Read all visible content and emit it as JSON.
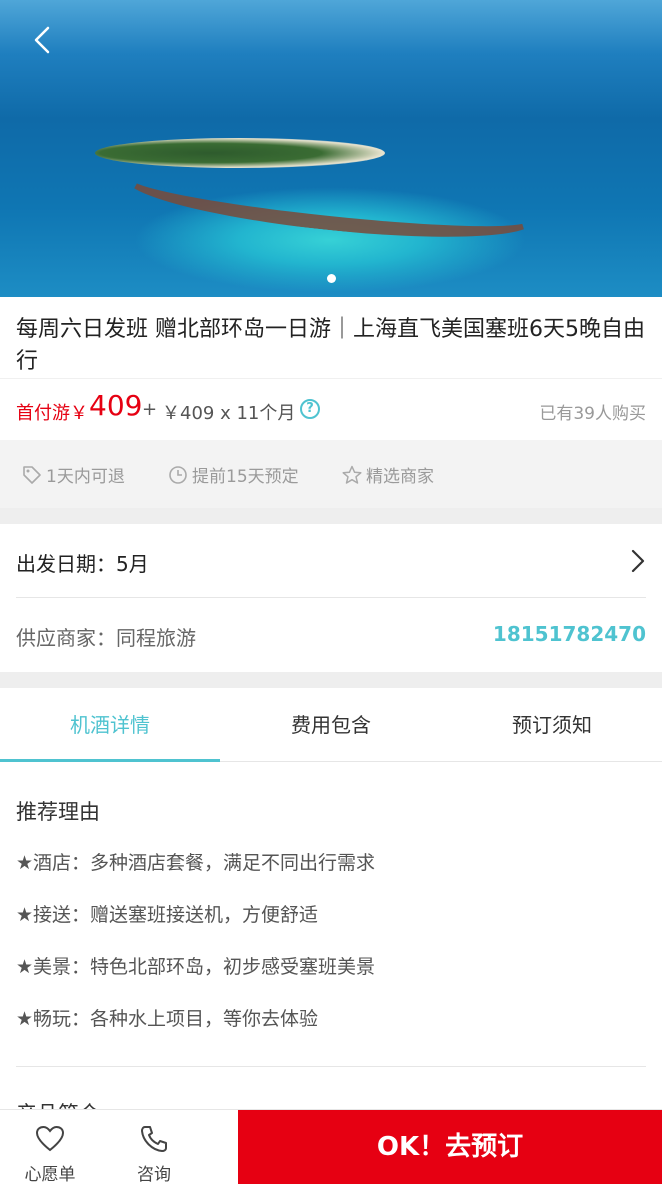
{
  "header": {
    "back_icon": "chevron-left-icon"
  },
  "banner": {
    "slide_count": 1,
    "active_slide": 1
  },
  "product": {
    "title": "每周六日发班 赠北部环岛一日游｜上海直飞美国塞班6天5晚自由行"
  },
  "price": {
    "first_pay_label": "首付游￥",
    "first_pay_amount": "409",
    "plus": "+",
    "monthly": "￥409 x 11个月",
    "help_icon": "question-circle-icon",
    "sold": "已有39人购买"
  },
  "tags": [
    {
      "icon": "tag-icon",
      "label": "1天内可退"
    },
    {
      "icon": "clock-icon",
      "label": "提前15天预定"
    },
    {
      "icon": "star-icon",
      "label": "精选商家"
    }
  ],
  "departure": {
    "label": "出发日期：5月"
  },
  "merchant": {
    "label": "供应商家：同程旅游",
    "phone": "18151782470"
  },
  "tabs": [
    {
      "label": "机酒详情",
      "active": true
    },
    {
      "label": "费用包含",
      "active": false
    },
    {
      "label": "预订须知",
      "active": false
    }
  ],
  "details": {
    "heading": "推荐理由",
    "items": [
      "★酒店：多种酒店套餐，满足不同出行需求",
      "★接送：赠送塞班接送机，方便舒适",
      "★美景：特色北部环岛，初步感受塞班美景",
      "★畅玩：各种水上项目，等你去体验"
    ],
    "next_heading": "产品简介"
  },
  "bottom_bar": {
    "wishlist": {
      "icon": "heart-icon",
      "label": "心愿单"
    },
    "consult": {
      "icon": "phone-icon",
      "label": "咨询"
    },
    "book_label": "OK！去预订"
  },
  "colors": {
    "accent": "#4fc3d0",
    "price": "#e60012",
    "book_button": "#e60012"
  }
}
